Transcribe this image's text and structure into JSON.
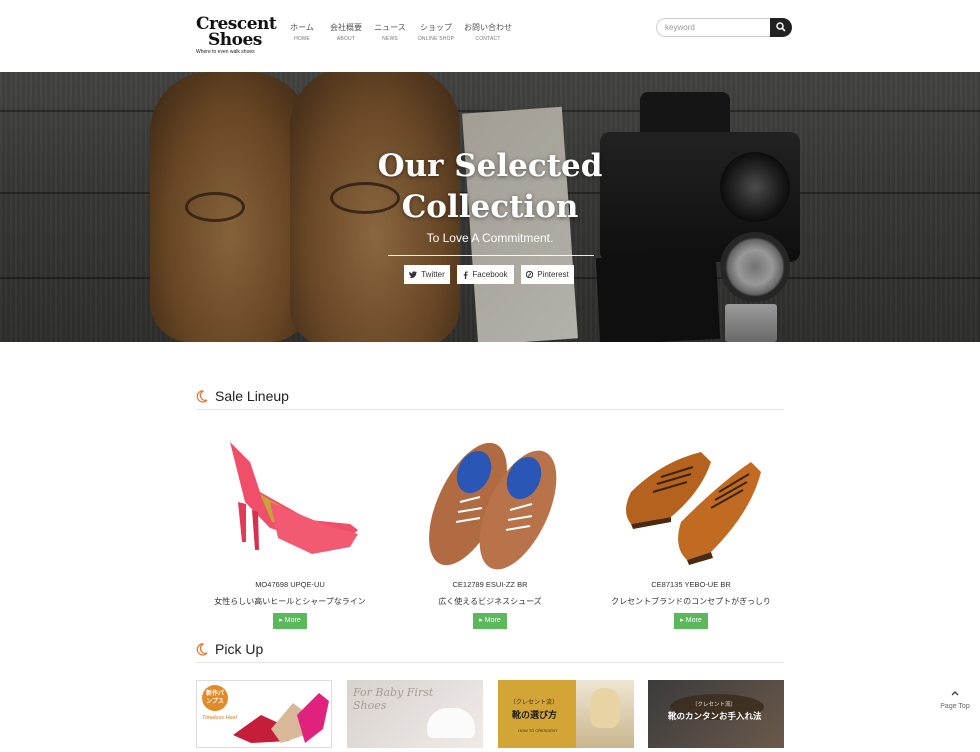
{
  "brand": {
    "line1": "Crescent",
    "line2": "Shoes",
    "tagline": "Where to even walk shoes"
  },
  "nav": [
    {
      "jp": "ホーム",
      "en": "HOME"
    },
    {
      "jp": "会社概要",
      "en": "ABOUT"
    },
    {
      "jp": "ニュース",
      "en": "NEWS"
    },
    {
      "jp": "ショップ",
      "en": "ONLINE SHOP"
    },
    {
      "jp": "お問い合わせ",
      "en": "CONTACT"
    }
  ],
  "search": {
    "placeholder": "keyword"
  },
  "hero": {
    "title_line1": "Our Selected",
    "title_line2": "Collection",
    "subtitle": "To Love A Commitment.",
    "share": {
      "twitter": "Twitter",
      "facebook": "Facebook",
      "pinterest": "Pinterest"
    }
  },
  "sale": {
    "title": "Sale Lineup",
    "products": [
      {
        "code": "MO47698 UPQE-UU",
        "desc": "女性らしい高いヒールとシャープなライン",
        "more": "More"
      },
      {
        "code": "CE12789 ESUI-ZZ BR",
        "desc": "広く使えるビジネスシューズ",
        "more": "More"
      },
      {
        "code": "CE87135 YEBO-UE BR",
        "desc": "クレセントブランドのコンセプトがぎっしり",
        "more": "More"
      }
    ]
  },
  "pickup": {
    "title": "Pick Up",
    "cards": [
      {
        "badge": "新作パンプス",
        "caption": "Timeless Heel"
      },
      {
        "caption": "For Baby First Shoes"
      },
      {
        "label": "〔クレセント流〕",
        "headline": "靴の選び方",
        "foot": "HOW TO CRESCENT"
      },
      {
        "label": "〔クレセント流〕",
        "headline": "靴のカンタンお手入れ法"
      }
    ]
  },
  "page_top": {
    "label": "Page Top"
  },
  "colors": {
    "accent_green": "#5cb85c",
    "crescent_orange": "#e07a3c",
    "dark": "#222222"
  }
}
